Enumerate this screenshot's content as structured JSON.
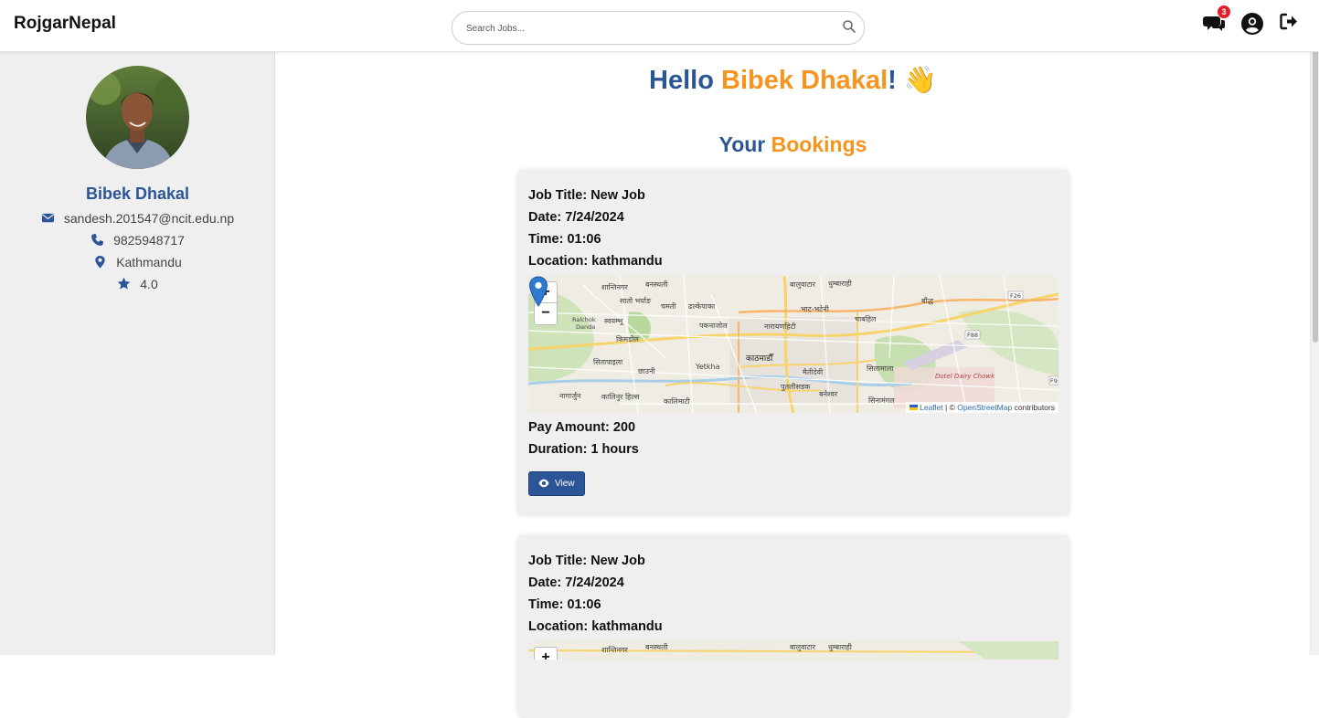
{
  "navbar": {
    "brand": "RojgarNepal",
    "search": {
      "placeholder": "Search Jobs...",
      "value": ""
    },
    "icons": {
      "messages": "comments-icon",
      "profile": "user-circle-icon",
      "logout": "sign-out-icon",
      "search": "search-icon"
    },
    "message_badge": "3"
  },
  "sidebar": {
    "name": "Bibek Dhakal",
    "email": "sandesh.201547@ncit.edu.np",
    "phone": "9825948717",
    "location": "Kathmandu",
    "rating": "4.0",
    "icons": [
      "envelope-icon",
      "phone-icon",
      "map-marker-icon",
      "star-icon"
    ]
  },
  "main": {
    "greeting_prefix": "Hello",
    "greeting_name": "Bibek Dhakal",
    "greeting_suffix": "! 👋",
    "section_title_a": "Your",
    "section_title_b": "Bookings",
    "bookings": [
      {
        "title": "Job Title: New Job",
        "date": "Date: 7/24/2024",
        "time": "Time: 01:06",
        "location": "Location: kathmandu",
        "pay": "Pay Amount: 200",
        "duration": "Duration: 1 hours",
        "view_label": "View"
      },
      {
        "title": "Job Title: New Job",
        "date": "Date: 7/24/2024",
        "time": "Time: 01:06",
        "location": "Location: kathmandu"
      }
    ],
    "map": {
      "zoom_in": "+",
      "zoom_out": "−",
      "attribution_leaflet": "Leaflet",
      "attribution_sep": " | © ",
      "attribution_osm": "OpenStreetMap",
      "attribution_tail": " contributors",
      "labels": [
        "शान्तिनगर",
        "बनस्थली",
        "बालुवाटार",
        "धुम्बाराही",
        "सातो भर्याङ",
        "ढल्केपाका",
        "भाट-भटेनी",
        "बौद्ध",
        "Ralchok Danda",
        "स्वयम्भू",
        "चमती",
        "पकनाजोल",
        "नारायणहिटी",
        "चाबहिल",
        "किमडोल",
        "काठमाडौँ",
        "सितापाइला",
        "Yetkha",
        "मैतीदेवी",
        "गौशाला",
        "छाउनी",
        "डल्लु",
        "सिलामाला",
        "पुतलीसडक",
        "बनेश्वर",
        "सिनामंगल",
        "नागार्जुन",
        "कालिमाटी",
        "कोटेश्वर",
        "Dotel Dairy Chowk",
        "F26",
        "F88",
        "F9"
      ]
    },
    "colors": {
      "accent_blue": "#2c5598",
      "accent_orange": "#f7941d",
      "badge_red": "#e0202a"
    }
  }
}
